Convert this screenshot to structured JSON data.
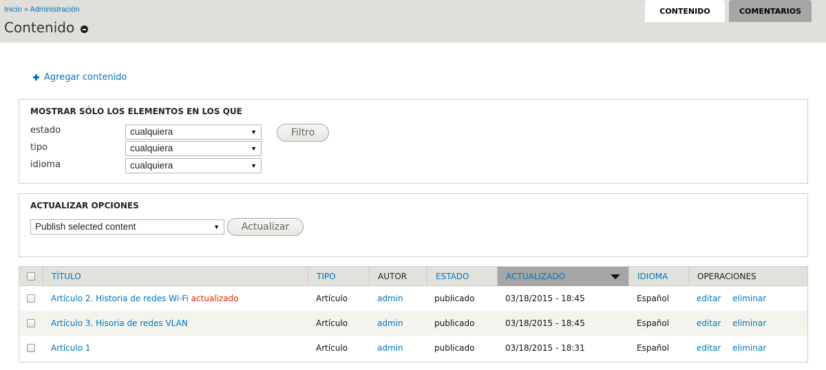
{
  "breadcrumb": {
    "home": "Inicio",
    "separator": "»",
    "admin": "Administración"
  },
  "page": {
    "title": "Contenido"
  },
  "tabs": [
    {
      "label": "CONTENIDO",
      "active": true
    },
    {
      "label": "COMENTARIOS",
      "active": false
    }
  ],
  "actions": {
    "add_content": "Agregar contenido"
  },
  "filter": {
    "legend": "MOSTRAR SÓLO LOS ELEMENTOS EN LOS QUE",
    "fields": [
      {
        "label": "estado",
        "value": "cualquiera"
      },
      {
        "label": "tipo",
        "value": "cualquiera"
      },
      {
        "label": "idioma",
        "value": "cualquiera"
      }
    ],
    "button": "Filtro"
  },
  "update": {
    "legend": "ACTUALIZAR OPCIONES",
    "select_value": "Publish selected content",
    "button": "Actualizar"
  },
  "table": {
    "headers": {
      "title": "TÍTULO",
      "type": "TIPO",
      "author": "AUTOR",
      "status": "ESTADO",
      "updated": "ACTUALIZADO",
      "language": "IDIOMA",
      "operations": "OPERACIONES"
    },
    "rows": [
      {
        "title": "Artículo 2. Historia de redes Wi-Fi",
        "mark": "actualizado",
        "type": "Artículo",
        "author": "admin",
        "status": "publicado",
        "updated": "03/18/2015 - 18:45",
        "language": "Español",
        "edit": "editar",
        "delete": "eliminar"
      },
      {
        "title": "Artículo 3. Hisoria de redes VLAN",
        "mark": "",
        "type": "Artículo",
        "author": "admin",
        "status": "publicado",
        "updated": "03/18/2015 - 18:45",
        "language": "Español",
        "edit": "editar",
        "delete": "eliminar"
      },
      {
        "title": "Artículo 1",
        "mark": "",
        "type": "Artículo",
        "author": "admin",
        "status": "publicado",
        "updated": "03/18/2015 - 18:31",
        "language": "Español",
        "edit": "editar",
        "delete": "eliminar"
      }
    ]
  },
  "colors": {
    "link": "#0074bd",
    "updated_mark": "#e62600",
    "header_bg": "#e0dfdc",
    "active_sort_bg": "#a6a6a6"
  }
}
